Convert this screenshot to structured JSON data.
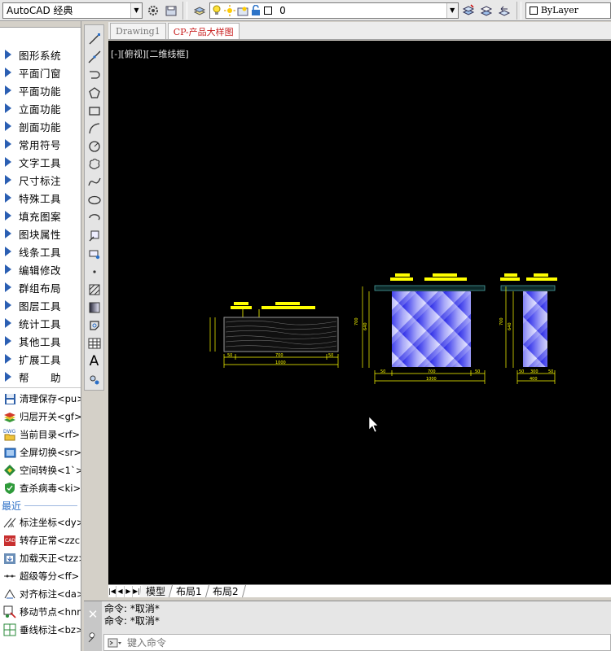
{
  "topbar": {
    "workspace": "AutoCAD 经典",
    "layer_value": "0",
    "color_value": "ByLayer"
  },
  "palette": {
    "menu_items": [
      {
        "label": "图形系统"
      },
      {
        "label": "平面门窗"
      },
      {
        "label": "平面功能"
      },
      {
        "label": "立面功能"
      },
      {
        "label": "剖面功能"
      },
      {
        "label": "常用符号"
      },
      {
        "label": "文字工具"
      },
      {
        "label": "尺寸标注"
      },
      {
        "label": "特殊工具"
      },
      {
        "label": "填充图案"
      },
      {
        "label": "图块属性"
      },
      {
        "label": "线条工具"
      },
      {
        "label": "编辑修改"
      },
      {
        "label": "群组布局"
      },
      {
        "label": "图层工具"
      },
      {
        "label": "统计工具"
      },
      {
        "label": "其他工具"
      },
      {
        "label": "扩展工具"
      },
      {
        "label": "帮　　助"
      }
    ],
    "commands": [
      {
        "label": "清理保存<pu>",
        "icon": "floppy-icon"
      },
      {
        "label": "归层开关<gf>",
        "icon": "layers-icon"
      },
      {
        "label": "当前目录<rf>",
        "icon": "dwg-folder-icon"
      },
      {
        "label": "全屏切换<sr>",
        "icon": "fullscreen-icon"
      },
      {
        "label": "空间转换<1`>",
        "icon": "space-switch-icon"
      },
      {
        "label": "查杀病毒<ki>",
        "icon": "shield-icon"
      }
    ],
    "recent_label": "最近",
    "recent": [
      {
        "label": "标注坐标<dy>",
        "icon": "coordinate-icon"
      },
      {
        "label": "转存正常<zzc>",
        "icon": "save-normal-icon"
      },
      {
        "label": "加载天正<tzz>",
        "icon": "load-icon"
      },
      {
        "label": "超级等分<ff>",
        "icon": "divide-icon"
      },
      {
        "label": "对齐标注<da>",
        "icon": "align-dim-icon"
      },
      {
        "label": "移动节点<hnn>",
        "icon": "move-node-icon"
      },
      {
        "label": "垂线标注<bz>",
        "icon": "perp-dim-icon"
      }
    ]
  },
  "doc_tabs": [
    {
      "label": "Drawing1",
      "active": false
    },
    {
      "label": "CP-产品大样图",
      "active": true
    }
  ],
  "viewport": {
    "label": "[-][俯视][二维线框]"
  },
  "layout_tabs": [
    {
      "label": "模型",
      "active": true
    },
    {
      "label": "布局1",
      "active": false
    },
    {
      "label": "布局2",
      "active": false
    }
  ],
  "command_line": {
    "history": [
      "命令: *取消*",
      "命令: *取消*"
    ],
    "placeholder": "键入命令"
  }
}
